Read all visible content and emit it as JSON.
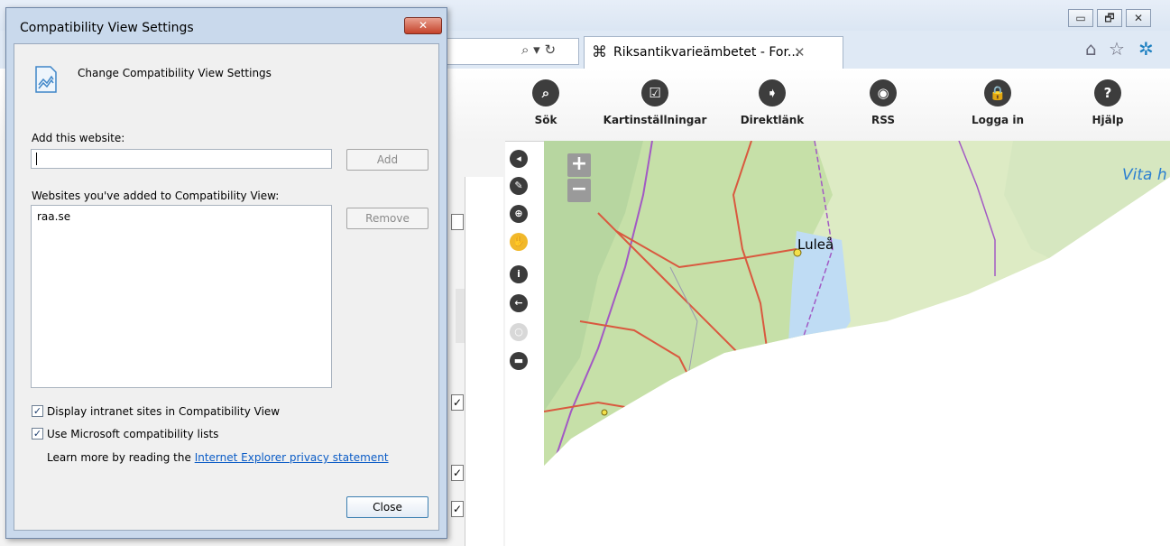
{
  "browser": {
    "window_buttons": [
      "▭",
      "🗗",
      "✕"
    ],
    "address_icons": "⌕ ▾ ↻",
    "tab": {
      "icon": "⌘",
      "label": "Riksantikvarieämbetet - For...",
      "close": "✕"
    },
    "icons": {
      "home": "⌂",
      "favorites": "☆",
      "tools": "✲"
    }
  },
  "toolbar": {
    "items": [
      {
        "label": "Sök",
        "glyph": "⌕",
        "icon": "search-icon"
      },
      {
        "label": "Kartinställningar",
        "glyph": "☑",
        "icon": "map-settings-icon"
      },
      {
        "label": "Direktlänk",
        "glyph": "➧",
        "icon": "direct-link-icon"
      },
      {
        "label": "RSS",
        "glyph": "◉",
        "icon": "rss-icon"
      },
      {
        "label": "Logga in",
        "glyph": "🔒",
        "icon": "lock-icon"
      },
      {
        "label": "Hjälp",
        "glyph": "?",
        "icon": "help-icon"
      }
    ]
  },
  "map_tools": {
    "items": [
      {
        "glyph": "◂",
        "icon": "collapse-panel-icon"
      },
      {
        "glyph": "✎",
        "icon": "measure-icon"
      },
      {
        "glyph": "⊕",
        "icon": "zoom-box-icon"
      },
      {
        "glyph": "✋",
        "icon": "pan-hand-icon"
      },
      {
        "glyph": "i",
        "icon": "info-icon"
      },
      {
        "glyph": "←",
        "icon": "back-icon"
      },
      {
        "glyph": "○",
        "icon": "polygon-icon"
      },
      {
        "glyph": "▬",
        "icon": "print-icon"
      }
    ],
    "zoom_in": "+",
    "zoom_out": "−"
  },
  "map": {
    "labels": {
      "lulea": "Luleå",
      "vita": "Vita h"
    }
  },
  "left_pane": {
    "checkmarks": [
      "✓",
      "✓",
      "✓"
    ]
  },
  "dialog": {
    "title": "Compatibility View Settings",
    "close_glyph": "✕",
    "heading": "Change Compatibility View Settings",
    "add_label": "Add this website:",
    "add_value": "",
    "add_button": "Add",
    "list_label": "Websites you've added to Compatibility View:",
    "sites": [
      "raa.se"
    ],
    "remove_button": "Remove",
    "checkbox_intranet": {
      "label": "Display intranet sites in Compatibility View",
      "checked": true,
      "mark": "✓"
    },
    "checkbox_ms_lists": {
      "label": "Use Microsoft compatibility lists",
      "checked": true,
      "mark": "✓"
    },
    "learn_prefix": "Learn more by reading the ",
    "learn_link": "Internet Explorer privacy statement",
    "close_button": "Close"
  },
  "colors": {
    "forest": "#c6e0a8",
    "meadow": "#ddebc4",
    "water": "#bfdcf4",
    "road": "#d9593f",
    "border": "#a259c4"
  }
}
